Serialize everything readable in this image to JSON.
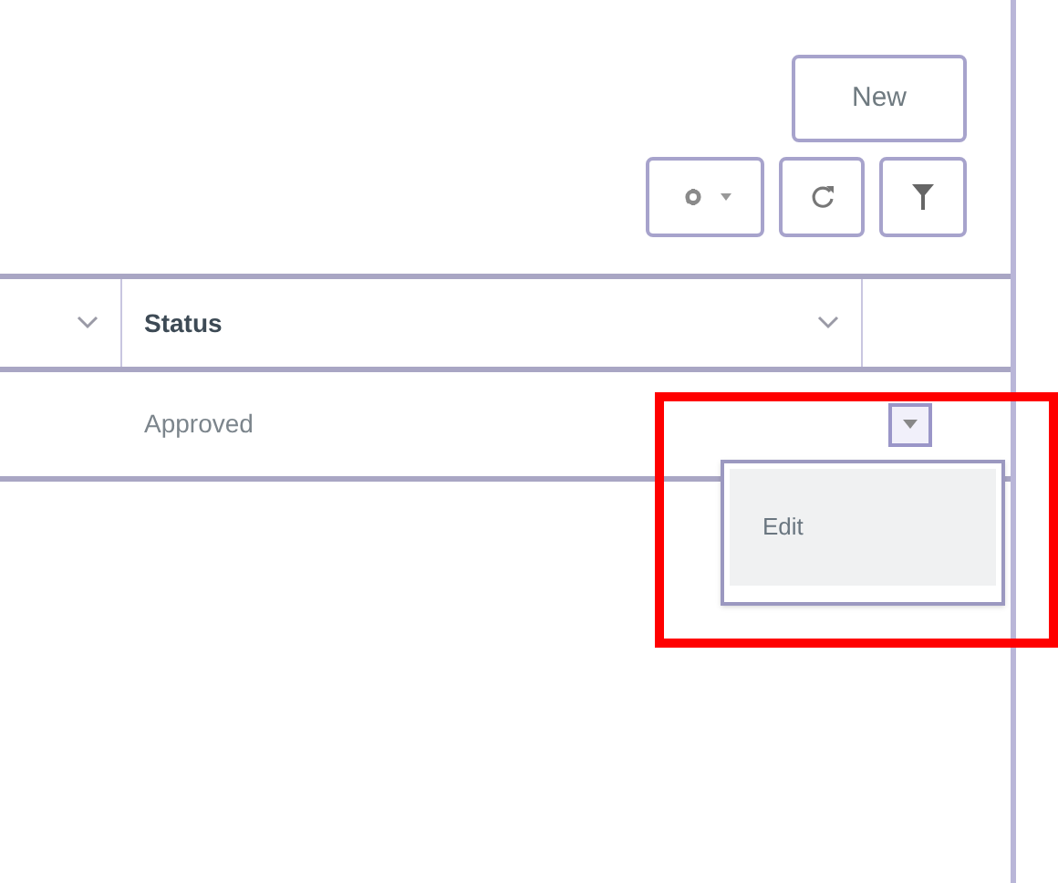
{
  "toolbar": {
    "new_button": "New"
  },
  "table": {
    "columns": [
      {
        "sortable": true
      },
      {
        "label": "Status",
        "sortable": true
      },
      {
        "sortable": false
      }
    ],
    "rows": [
      {
        "cells": [
          "",
          "Approved"
        ],
        "menu_open": true
      }
    ]
  },
  "row_menu": {
    "items": [
      {
        "label": "Edit",
        "selected": true
      }
    ]
  }
}
